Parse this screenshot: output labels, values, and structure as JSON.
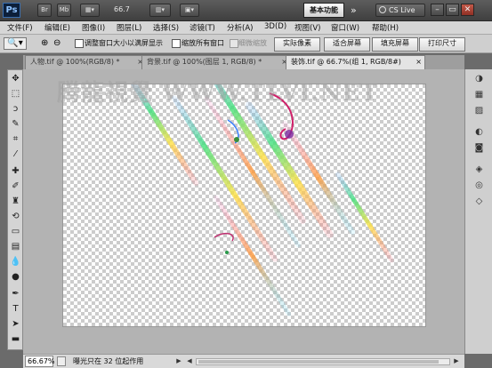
{
  "appbar": {
    "logo": "Ps",
    "buttons": [
      "Br",
      "Mb"
    ],
    "zoom": "66.7",
    "workspace": "基本功能",
    "more": "»",
    "cslive": "CS Live",
    "win": [
      "–",
      "▭",
      "✕"
    ]
  },
  "menu": [
    "文件(F)",
    "编辑(E)",
    "图像(I)",
    "图层(L)",
    "选择(S)",
    "滤镜(T)",
    "分析(A)",
    "3D(D)",
    "视图(V)",
    "窗口(W)",
    "帮助(H)"
  ],
  "options": {
    "resize_windows": "调整窗口大小以满屏显示",
    "zoom_all": "缩放所有窗口",
    "scrubby_zoom": "细微缩放",
    "actual_pixels": "实际像素",
    "fit_screen": "适合屏幕",
    "fill_screen": "填充屏幕",
    "print_size": "打印尺寸"
  },
  "tabs": [
    {
      "label": "人物.tif @ 100%(RGB/8) *",
      "close": "×"
    },
    {
      "label": "背景.tif @ 100%(图层 1, RGB/8) *",
      "close": "×"
    },
    {
      "label": "装饰.tif @ 66.7%(组 1, RGB/8#)",
      "close": "×"
    }
  ],
  "watermark": "腾龍視覺 WWW.TLVI.NET",
  "status": {
    "zoom": "66.67%",
    "message": "曝光只在 32 位起作用",
    "prev": "◀",
    "next": "▶"
  },
  "colors": {
    "accent": "#3a6fb0",
    "ps_logo_bg": "#0c1f3a"
  }
}
